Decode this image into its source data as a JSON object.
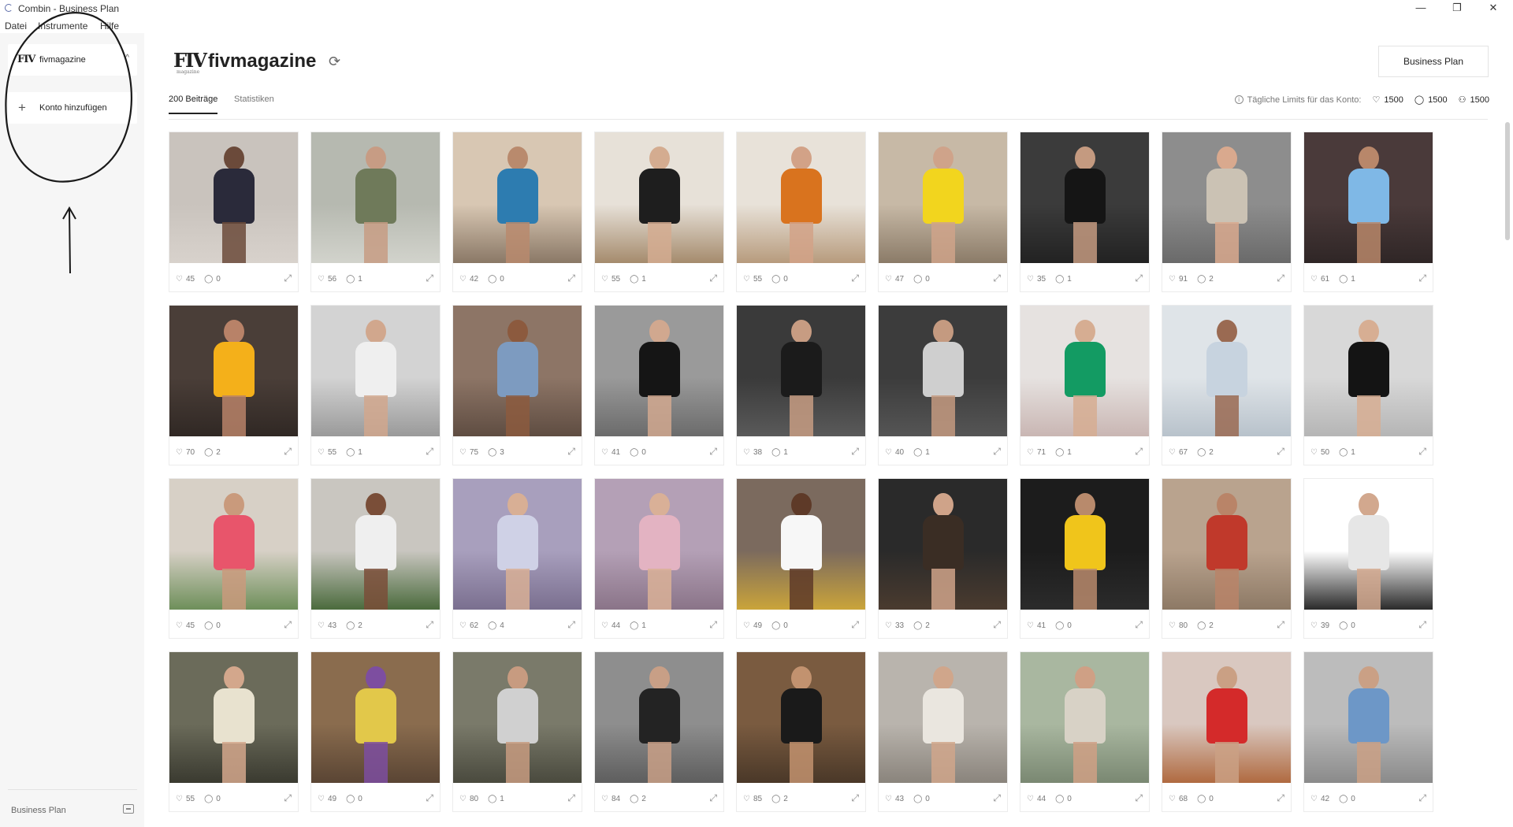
{
  "window": {
    "title": "Combin - Business Plan",
    "minimize": "—",
    "maximize": "❐",
    "close": "✕"
  },
  "menu": [
    "Datei",
    "Instrumente",
    "Hilfe"
  ],
  "sidebar": {
    "account": {
      "logo": "FIV",
      "name": "fivmagazine",
      "chevron": "^"
    },
    "add_account": {
      "plus": "+",
      "label": "Konto hinzufügen"
    },
    "footer": {
      "plan": "Business Plan"
    }
  },
  "header": {
    "logo": "FIV",
    "logo_sub": "magazine",
    "name": "fivmagazine",
    "refresh_icon": "⟳",
    "plan_button": "Business Plan"
  },
  "tabs": [
    {
      "label": "200 Beiträge",
      "active": true
    },
    {
      "label": "Statistiken",
      "active": false
    }
  ],
  "limits": {
    "note": "Tägliche Limits für das Konto:",
    "likes": "1500",
    "comments": "1500",
    "follows": "1500"
  },
  "posts": [
    {
      "likes": "45",
      "comments": "0",
      "tone": "#c9c3bd",
      "skin": "#6b4a3a",
      "outfit": "#2a2a3a",
      "bg2": "#d8d2cc"
    },
    {
      "likes": "56",
      "comments": "1",
      "tone": "#b6b9b0",
      "skin": "#c79c84",
      "outfit": "#6f7a5a",
      "bg2": "#d2d3cc"
    },
    {
      "likes": "42",
      "comments": "0",
      "tone": "#d8c7b3",
      "skin": "#b98a6d",
      "outfit": "#2d7cb0",
      "bg2": "#8a7866"
    },
    {
      "likes": "55",
      "comments": "1",
      "tone": "#e7e1d8",
      "skin": "#d4ac90",
      "outfit": "#1e1e1e",
      "bg2": "#a58b6d"
    },
    {
      "likes": "55",
      "comments": "0",
      "tone": "#e8e2d9",
      "skin": "#d2a287",
      "outfit": "#d9731e",
      "bg2": "#b79b7d"
    },
    {
      "likes": "47",
      "comments": "0",
      "tone": "#c7b9a6",
      "skin": "#cfa38a",
      "outfit": "#f2d51e",
      "bg2": "#8b7b68"
    },
    {
      "likes": "35",
      "comments": "1",
      "tone": "#3b3b3b",
      "skin": "#c49a80",
      "outfit": "#151515",
      "bg2": "#222222"
    },
    {
      "likes": "91",
      "comments": "2",
      "tone": "#8d8d8d",
      "skin": "#d9a98e",
      "outfit": "#cbc2b4",
      "bg2": "#6a6a6a"
    },
    {
      "likes": "61",
      "comments": "1",
      "tone": "#4a3a3a",
      "skin": "#b8876a",
      "outfit": "#7fb8e6",
      "bg2": "#2f2626"
    },
    {
      "likes": "70",
      "comments": "2",
      "tone": "#4a3e38",
      "skin": "#b88268",
      "outfit": "#f4b01a",
      "bg2": "#302824"
    },
    {
      "likes": "55",
      "comments": "1",
      "tone": "#d3d3d3",
      "skin": "#d1a78d",
      "outfit": "#efefef",
      "bg2": "#9a9a9a"
    },
    {
      "likes": "75",
      "comments": "3",
      "tone": "#8d7566",
      "skin": "#8c5a3e",
      "outfit": "#7d9bc0",
      "bg2": "#5f4d42"
    },
    {
      "likes": "41",
      "comments": "0",
      "tone": "#9a9a9a",
      "skin": "#d1a88f",
      "outfit": "#151515",
      "bg2": "#6b6b6b"
    },
    {
      "likes": "38",
      "comments": "1",
      "tone": "#3a3a3a",
      "skin": "#c79c82",
      "outfit": "#1b1b1b",
      "bg2": "#5a5a5a"
    },
    {
      "likes": "40",
      "comments": "1",
      "tone": "#3c3c3c",
      "skin": "#c49a80",
      "outfit": "#cfcfcf",
      "bg2": "#555555"
    },
    {
      "likes": "71",
      "comments": "1",
      "tone": "#e6e2e0",
      "skin": "#d6ad92",
      "outfit": "#139b63",
      "bg2": "#c9b6b3"
    },
    {
      "likes": "67",
      "comments": "2",
      "tone": "#dfe4e8",
      "skin": "#9a6a52",
      "outfit": "#c7d3df",
      "bg2": "#b8c2cb"
    },
    {
      "likes": "50",
      "comments": "1",
      "tone": "#d8d8d8",
      "skin": "#d7ae93",
      "outfit": "#141414",
      "bg2": "#b5b5b5"
    },
    {
      "likes": "45",
      "comments": "0",
      "tone": "#d7d0c6",
      "skin": "#c99a7c",
      "outfit": "#e8556b",
      "bg2": "#6e8f5a"
    },
    {
      "likes": "43",
      "comments": "2",
      "tone": "#c9c6c0",
      "skin": "#7a4e38",
      "outfit": "#efefef",
      "bg2": "#4b6b3d"
    },
    {
      "likes": "62",
      "comments": "4",
      "tone": "#a89fbd",
      "skin": "#d8af95",
      "outfit": "#cfd1e6",
      "bg2": "#7a6f8f"
    },
    {
      "likes": "44",
      "comments": "1",
      "tone": "#b4a0b6",
      "skin": "#d9b097",
      "outfit": "#e3b3c2",
      "bg2": "#8a7488"
    },
    {
      "likes": "49",
      "comments": "0",
      "tone": "#7b6a5e",
      "skin": "#5e3a28",
      "outfit": "#f7f7f7",
      "bg2": "#caa43a"
    },
    {
      "likes": "33",
      "comments": "2",
      "tone": "#2a2a2a",
      "skin": "#cfa389",
      "outfit": "#3a2d24",
      "bg2": "#4a3b2f"
    },
    {
      "likes": "41",
      "comments": "0",
      "tone": "#1c1c1c",
      "skin": "#b88a6c",
      "outfit": "#f0c51b",
      "bg2": "#2b2b2b"
    },
    {
      "likes": "80",
      "comments": "2",
      "tone": "#b9a38e",
      "skin": "#b98468",
      "outfit": "#c0392b",
      "bg2": "#8d7965"
    },
    {
      "likes": "39",
      "comments": "0",
      "tone": "#ffffff",
      "skin": "#d2a88e",
      "outfit": "#e6e6e6",
      "bg2": "#2a2a2a"
    },
    {
      "likes": "55",
      "comments": "0",
      "tone": "#6b6b5a",
      "skin": "#d3a78c",
      "outfit": "#e8e2cf",
      "bg2": "#3a3a30"
    },
    {
      "likes": "49",
      "comments": "0",
      "tone": "#8a6c4e",
      "skin": "#7d4ea0",
      "outfit": "#e2c84a",
      "bg2": "#5a4534"
    },
    {
      "likes": "80",
      "comments": "1",
      "tone": "#7a7a6a",
      "skin": "#c79b80",
      "outfit": "#d0d0d0",
      "bg2": "#4a4a3e"
    },
    {
      "likes": "84",
      "comments": "2",
      "tone": "#8e8e8e",
      "skin": "#c89f86",
      "outfit": "#232323",
      "bg2": "#5e5e5e"
    },
    {
      "likes": "85",
      "comments": "2",
      "tone": "#7a5b40",
      "skin": "#c2926f",
      "outfit": "#1a1a1a",
      "bg2": "#4a3828"
    },
    {
      "likes": "43",
      "comments": "0",
      "tone": "#b9b4ad",
      "skin": "#d0a68b",
      "outfit": "#eae6df",
      "bg2": "#8a847c"
    },
    {
      "likes": "44",
      "comments": "0",
      "tone": "#a9b7a0",
      "skin": "#cfa085",
      "outfit": "#d8d2c6",
      "bg2": "#7a8872"
    },
    {
      "likes": "68",
      "comments": "0",
      "tone": "#d9c8c0",
      "skin": "#caa084",
      "outfit": "#d42a2a",
      "bg2": "#b06a40"
    },
    {
      "likes": "42",
      "comments": "0",
      "tone": "#bcbcbc",
      "skin": "#caa085",
      "outfit": "#6d97c7",
      "bg2": "#8a8a8a"
    }
  ],
  "colors": {
    "accent": "#222222",
    "muted": "#777777",
    "sidebar_bg": "#f6f6f6"
  }
}
